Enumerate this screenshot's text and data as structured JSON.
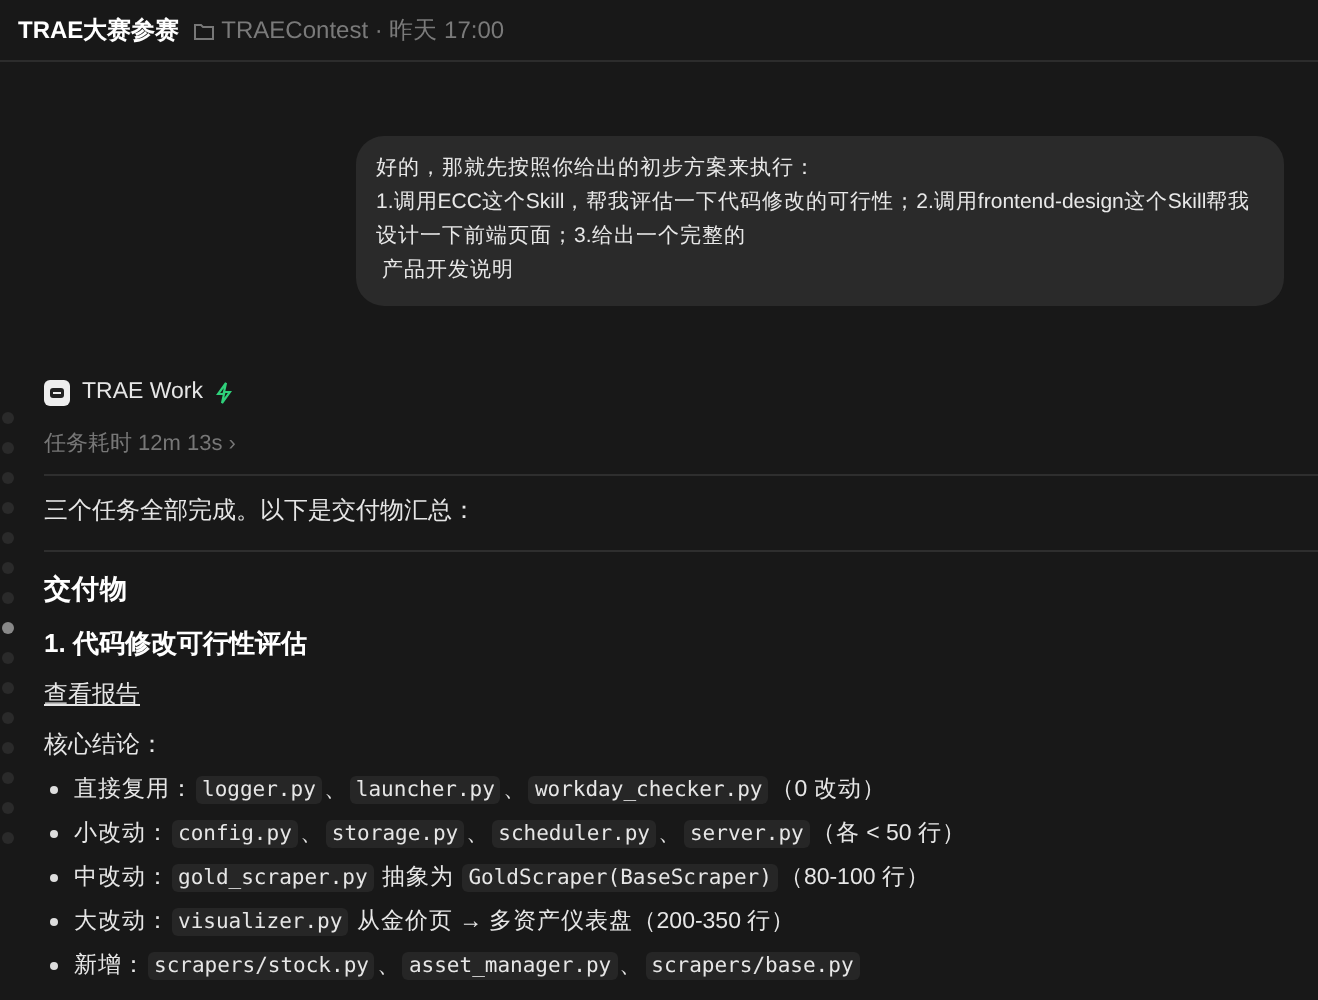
{
  "header": {
    "title": "TRAE大赛参赛",
    "meta": "TRAEContest · 昨天 17:00"
  },
  "user_message": {
    "lines": [
      "好的，那就先按照你给出的初步方案来执行：",
      "1.调用ECC这个Skill，帮我评估一下代码修改的可行性；2.调用frontend-design这个Skill帮我设计一下前端页面；3.给出一个完整的",
      " 产品开发说明"
    ]
  },
  "nav_dots": [
    {
      "selected": false
    },
    {
      "selected": false
    },
    {
      "selected": false
    },
    {
      "selected": false
    },
    {
      "selected": false
    },
    {
      "selected": false
    },
    {
      "selected": false
    },
    {
      "selected": true
    },
    {
      "selected": false
    },
    {
      "selected": false
    },
    {
      "selected": false
    },
    {
      "selected": false
    },
    {
      "selected": false
    },
    {
      "selected": false
    },
    {
      "selected": false
    }
  ],
  "agent": {
    "name": "TRAE Work",
    "duration": "任务耗时 12m 13s ›",
    "summary": "三个任务全部完成。以下是交付物汇总：",
    "blocks": [
      {
        "kind": "h2",
        "text": "交付物"
      },
      {
        "kind": "h3",
        "text": "1. 代码修改可行性评估"
      },
      {
        "kind": "link",
        "text": "查看报告"
      },
      {
        "kind": "p",
        "text": "核心结论："
      },
      {
        "kind": "bullet",
        "parts": [
          {
            "kind": "text",
            "text": "直接复用："
          },
          {
            "kind": "code",
            "text": "logger.py"
          },
          {
            "kind": "text",
            "text": "、"
          },
          {
            "kind": "code",
            "text": "launcher.py"
          },
          {
            "kind": "text",
            "text": "、"
          },
          {
            "kind": "code",
            "text": "workday_checker.py"
          },
          {
            "kind": "text",
            "text": "（0 改动）"
          }
        ]
      },
      {
        "kind": "bullet",
        "parts": [
          {
            "kind": "text",
            "text": "小改动："
          },
          {
            "kind": "code",
            "text": "config.py"
          },
          {
            "kind": "text",
            "text": "、"
          },
          {
            "kind": "code",
            "text": "storage.py"
          },
          {
            "kind": "text",
            "text": "、"
          },
          {
            "kind": "code",
            "text": "scheduler.py"
          },
          {
            "kind": "text",
            "text": "、"
          },
          {
            "kind": "code",
            "text": "server.py"
          },
          {
            "kind": "text",
            "text": "（各 < 50 行）"
          }
        ]
      },
      {
        "kind": "bullet",
        "parts": [
          {
            "kind": "text",
            "text": "中改动："
          },
          {
            "kind": "code",
            "text": "gold_scraper.py"
          },
          {
            "kind": "text",
            "text": " 抽象为 "
          },
          {
            "kind": "code",
            "text": "GoldScraper(BaseScraper)"
          },
          {
            "kind": "text",
            "text": "（80-100 行）"
          }
        ]
      },
      {
        "kind": "bullet",
        "parts": [
          {
            "kind": "text",
            "text": "大改动："
          },
          {
            "kind": "code",
            "text": "visualizer.py"
          },
          {
            "kind": "text",
            "text": " 从金价页 → 多资产仪表盘（200-350 行）"
          }
        ]
      },
      {
        "kind": "bullet",
        "parts": [
          {
            "kind": "text",
            "text": "新增："
          },
          {
            "kind": "code",
            "text": "scrapers/stock.py"
          },
          {
            "kind": "text",
            "text": "、"
          },
          {
            "kind": "code",
            "text": "asset_manager.py"
          },
          {
            "kind": "text",
            "text": "、"
          },
          {
            "kind": "code",
            "text": "scrapers/base.py"
          }
        ]
      }
    ]
  }
}
